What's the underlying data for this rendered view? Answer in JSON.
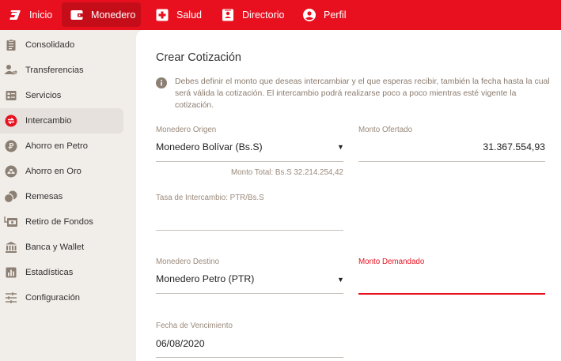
{
  "topnav": [
    {
      "label": "Inicio",
      "icon": "logo-icon"
    },
    {
      "label": "Monedero",
      "icon": "wallet-icon"
    },
    {
      "label": "Salud",
      "icon": "medical-cross-icon"
    },
    {
      "label": "Directorio",
      "icon": "contact-card-icon"
    },
    {
      "label": "Perfil",
      "icon": "user-circle-icon"
    }
  ],
  "sidebar": {
    "items": [
      {
        "label": "Consolidado",
        "icon": "clipboard-icon"
      },
      {
        "label": "Transferencias",
        "icon": "person-transfer-icon"
      },
      {
        "label": "Servicios",
        "icon": "services-list-icon"
      },
      {
        "label": "Intercambio",
        "icon": "exchange-icon"
      },
      {
        "label": "Ahorro en Petro",
        "icon": "petro-coin-icon"
      },
      {
        "label": "Ahorro en Oro",
        "icon": "gold-bars-icon"
      },
      {
        "label": "Remesas",
        "icon": "coins-icon"
      },
      {
        "label": "Retiro de Fondos",
        "icon": "withdraw-icon"
      },
      {
        "label": "Banca y Wallet",
        "icon": "bank-icon"
      },
      {
        "label": "Estadísticas",
        "icon": "chart-icon"
      },
      {
        "label": "Configuración",
        "icon": "sliders-icon"
      }
    ],
    "active_index": 3
  },
  "form": {
    "title": "Crear Cotización",
    "info_text": "Debes definir el monto que deseas intercambiar y el que esperas recibir, también la fecha hasta la cual será válida la cotización. El intercambio podrá realizarse poco a poco mientras esté vigente la cotización.",
    "origin_label": "Monedero Origen",
    "origin_value": "Monedero Bolívar (Bs.S)",
    "offered_label": "Monto Ofertado",
    "offered_value": "31.367.554,93",
    "total_helper": "Monto Total: Bs.S 32.214.254,42",
    "rate_label": "Tasa de Intercambio: PTR/Bs.S",
    "rate_value": "",
    "dest_label": "Monedero Destino",
    "dest_value": "Monedero Petro (PTR)",
    "demanded_label": "Monto Demandado",
    "demanded_value": "",
    "expiry_label": "Fecha de Vencimiento",
    "expiry_value": "06/08/2020"
  },
  "colors": {
    "brand_red": "#e8101f",
    "active_nav": "#c50d1a",
    "sidebar_bg": "#f1ede9"
  }
}
